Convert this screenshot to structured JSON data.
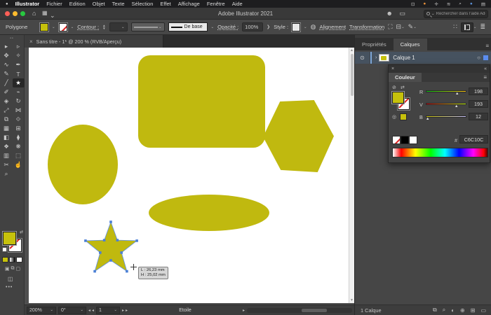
{
  "menubar": {
    "apple_icon": "●",
    "items": [
      "Illustrator",
      "Fichier",
      "Edition",
      "Objet",
      "Texte",
      "Sélection",
      "Effet",
      "Affichage",
      "Fenêtre",
      "Aide"
    ],
    "status_icons": [
      {
        "name": "display-icon",
        "glyph": "⊡"
      },
      {
        "name": "screen-record-icon",
        "glyph": "●"
      },
      {
        "name": "update-icon",
        "glyph": "✛"
      },
      {
        "name": "wifi-icon",
        "glyph": "≋"
      },
      {
        "name": "spotlight-icon",
        "glyph": "⌕"
      },
      {
        "name": "siri-icon",
        "glyph": "●"
      },
      {
        "name": "control-center-icon",
        "glyph": "▤"
      }
    ]
  },
  "titlebar": {
    "home_icon": "⌂",
    "title": "Adobe Illustrator 2021",
    "share_icon": "☻",
    "arrange_icon": "▭",
    "search_placeholder": "Rechercher dans l'aide Adobe"
  },
  "controlbar": {
    "shape_label": "Polygone",
    "contour_label": "Contour :",
    "brush_name": "De base",
    "opacity_label": "Opacité :",
    "opacity_value": "100%",
    "divider": "❯",
    "style_label": "Style :",
    "doc_setup_icon": "◍",
    "align_label": "Alignement",
    "transform_label": "Transformation",
    "isolate_icon": "⛶",
    "arrange_icon": "⊟",
    "effects_icon": "✎",
    "dots_icon": "∷",
    "panel_list_icon": "≣"
  },
  "tabbar": {
    "close": "×",
    "doc_title": "Sans titre - 1* @ 200 % (RVB/Aperçu)"
  },
  "toolbar": {
    "grip": "••",
    "tools": [
      {
        "name": "selection-tool",
        "glyph": "▸"
      },
      {
        "name": "direct-selection-tool",
        "glyph": "▹"
      },
      {
        "name": "group-selection-tool",
        "glyph": "✥"
      },
      {
        "name": "magic-wand-tool",
        "glyph": "✧"
      },
      {
        "name": "lasso-tool",
        "glyph": "∿"
      },
      {
        "name": "pen-tool",
        "glyph": "✒"
      },
      {
        "name": "curvature-tool",
        "glyph": "✎"
      },
      {
        "name": "type-tool",
        "glyph": "T"
      },
      {
        "name": "line-tool",
        "glyph": "╱"
      },
      {
        "name": "star-tool",
        "glyph": "★",
        "selected": true
      },
      {
        "name": "paintbrush-tool",
        "glyph": "✐"
      },
      {
        "name": "shaper-tool",
        "glyph": "⌁"
      },
      {
        "name": "eraser-tool",
        "glyph": "◈"
      },
      {
        "name": "rotate-tool",
        "glyph": "↻"
      },
      {
        "name": "scale-tool",
        "glyph": "⤢"
      },
      {
        "name": "width-tool",
        "glyph": "⋈"
      },
      {
        "name": "free-transform-tool",
        "glyph": "⧉"
      },
      {
        "name": "shape-builder-tool",
        "glyph": "⟐"
      },
      {
        "name": "perspective-grid-tool",
        "glyph": "▦"
      },
      {
        "name": "mesh-tool",
        "glyph": "⊞"
      },
      {
        "name": "gradient-tool",
        "glyph": "◧"
      },
      {
        "name": "eyedropper-tool",
        "glyph": "⧫"
      },
      {
        "name": "blend-tool",
        "glyph": "❖"
      },
      {
        "name": "symbol-sprayer-tool",
        "glyph": "❋"
      },
      {
        "name": "graph-tool",
        "glyph": "▥"
      },
      {
        "name": "artboard-tool",
        "glyph": "⬚"
      },
      {
        "name": "slice-tool",
        "glyph": "✂"
      },
      {
        "name": "hand-tool",
        "glyph": "☝"
      },
      {
        "name": "zoom-tool",
        "glyph": "⌕"
      }
    ],
    "overflow": "•••"
  },
  "canvas": {
    "tooltip": {
      "line1": "L : 26,23 mm",
      "line2": "H : 25,02 mm"
    }
  },
  "rightpanel": {
    "tabs": {
      "properties": "Propriétés",
      "layers": "Calques"
    },
    "panel_menu_icon": "≡",
    "layer": {
      "expand": "›",
      "eye_icon": "⊙",
      "name": "Calque 1",
      "target_icon": "○"
    },
    "footer": {
      "count": "1 Calque",
      "icons": [
        {
          "name": "collect-for-export-icon",
          "glyph": "⧉"
        },
        {
          "name": "locate-object-icon",
          "glyph": "⌕"
        },
        {
          "name": "clipping-mask-icon",
          "glyph": "◐"
        },
        {
          "name": "new-sublayer-icon",
          "glyph": "⊕"
        },
        {
          "name": "new-layer-icon",
          "glyph": "⊞"
        },
        {
          "name": "delete-layer-icon",
          "glyph": "▭"
        }
      ]
    }
  },
  "couleur": {
    "close": "×",
    "collapse": "«",
    "title": "Couleur",
    "menu_icon": "≡",
    "none_icon": "⊘",
    "swap_icon": "⇄",
    "grayscale_icon": "◎",
    "sliders": [
      {
        "label": "R",
        "value": "198"
      },
      {
        "label": "V",
        "value": "193"
      },
      {
        "label": "B",
        "value": "12"
      }
    ],
    "hex_label": "#",
    "hex_value": "C6C10C"
  },
  "statusbar": {
    "zoom": "200%",
    "rotation": "0°",
    "first": "◂",
    "prev": "◂",
    "page": "1",
    "next": "▸",
    "last": "▸",
    "tool_name": "Etoile",
    "tool_arrow": "▸"
  },
  "colors": {
    "shape_fill": "#c0b90f",
    "swatch": "#c6c10c",
    "selection_accent": "#4a7fd6"
  }
}
